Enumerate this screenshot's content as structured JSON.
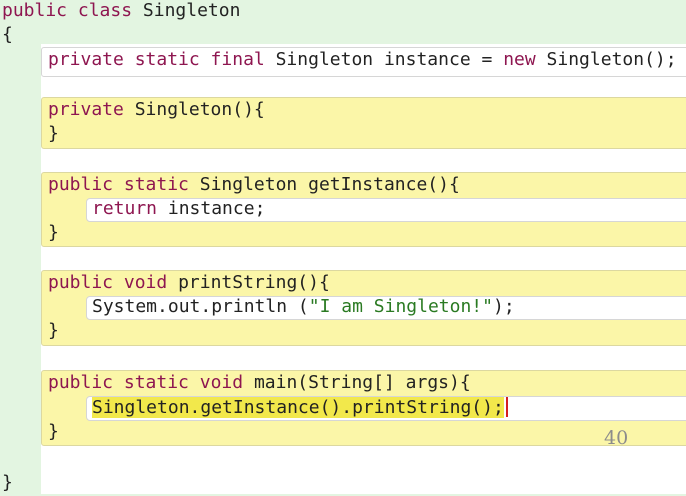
{
  "code": {
    "class_decl": {
      "kw": "public class",
      "name": "Singleton"
    },
    "open_brace": "{",
    "close_brace": "}",
    "field": {
      "kw": "private static final",
      "type": "Singleton instance =",
      "new_kw": "new",
      "rest": "Singleton();"
    },
    "ctor": {
      "kw": "private",
      "rest": "Singleton(){",
      "close": "}"
    },
    "get_instance": {
      "kw": "public static",
      "rest": "Singleton getInstance(){",
      "ret_kw": "return",
      "ret_val": "instance;",
      "close": "}"
    },
    "print_string": {
      "kw": "public",
      "void_kw": "void",
      "rest": "printString(){",
      "call": "System.out.println (",
      "string": "\"I am Singleton!\"",
      "call_end": ");",
      "close": "}"
    },
    "main": {
      "kw": "public static",
      "void_kw": "void",
      "rest": "main(String[] args){",
      "call": "Singleton.getInstance().printString();",
      "close": "}"
    }
  },
  "page_number": "40",
  "colors": {
    "background": "#e3f5e1",
    "block": "#fbf6a8",
    "keyword": "#8e1650",
    "string": "#2a7a22",
    "highlight": "#f2e84b"
  }
}
